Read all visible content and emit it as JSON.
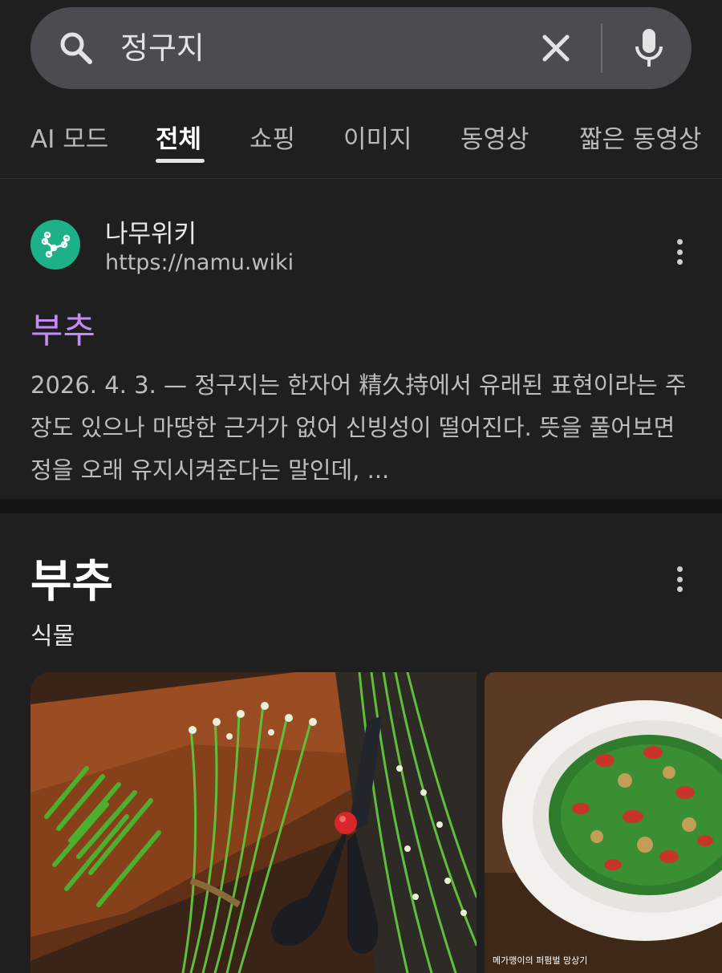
{
  "search": {
    "query": "정구지",
    "icons": {
      "search": "search-icon",
      "clear": "close-icon",
      "voice": "mic-icon"
    }
  },
  "tabs": [
    {
      "label": "AI 모드",
      "active": false
    },
    {
      "label": "전체",
      "active": true
    },
    {
      "label": "쇼핑",
      "active": false
    },
    {
      "label": "이미지",
      "active": false
    },
    {
      "label": "동영상",
      "active": false
    },
    {
      "label": "짧은 동영상",
      "active": false
    }
  ],
  "result": {
    "site_name": "나무위키",
    "url": "https://namu.wiki",
    "title": "부추",
    "snippet": "2026. 4. 3. — 정구지는 한자어 精久持에서 유래된 표현이라는 주장도 있으나 마땅한 근거가 없어 신빙성이 떨어진다. 뜻을 풀어보면 정을 오래 유지시켜준다는 말인데, ...",
    "favicon_color": "#1db18a"
  },
  "knowledge_panel": {
    "title": "부추",
    "subtitle": "식물",
    "image_captions": {
      "second": "메가맹이의 퍼펌벌 망상기"
    }
  },
  "colors": {
    "background": "#1f1f1f",
    "search_bar": "#4b4c4f",
    "link_title": "#c58af9"
  }
}
